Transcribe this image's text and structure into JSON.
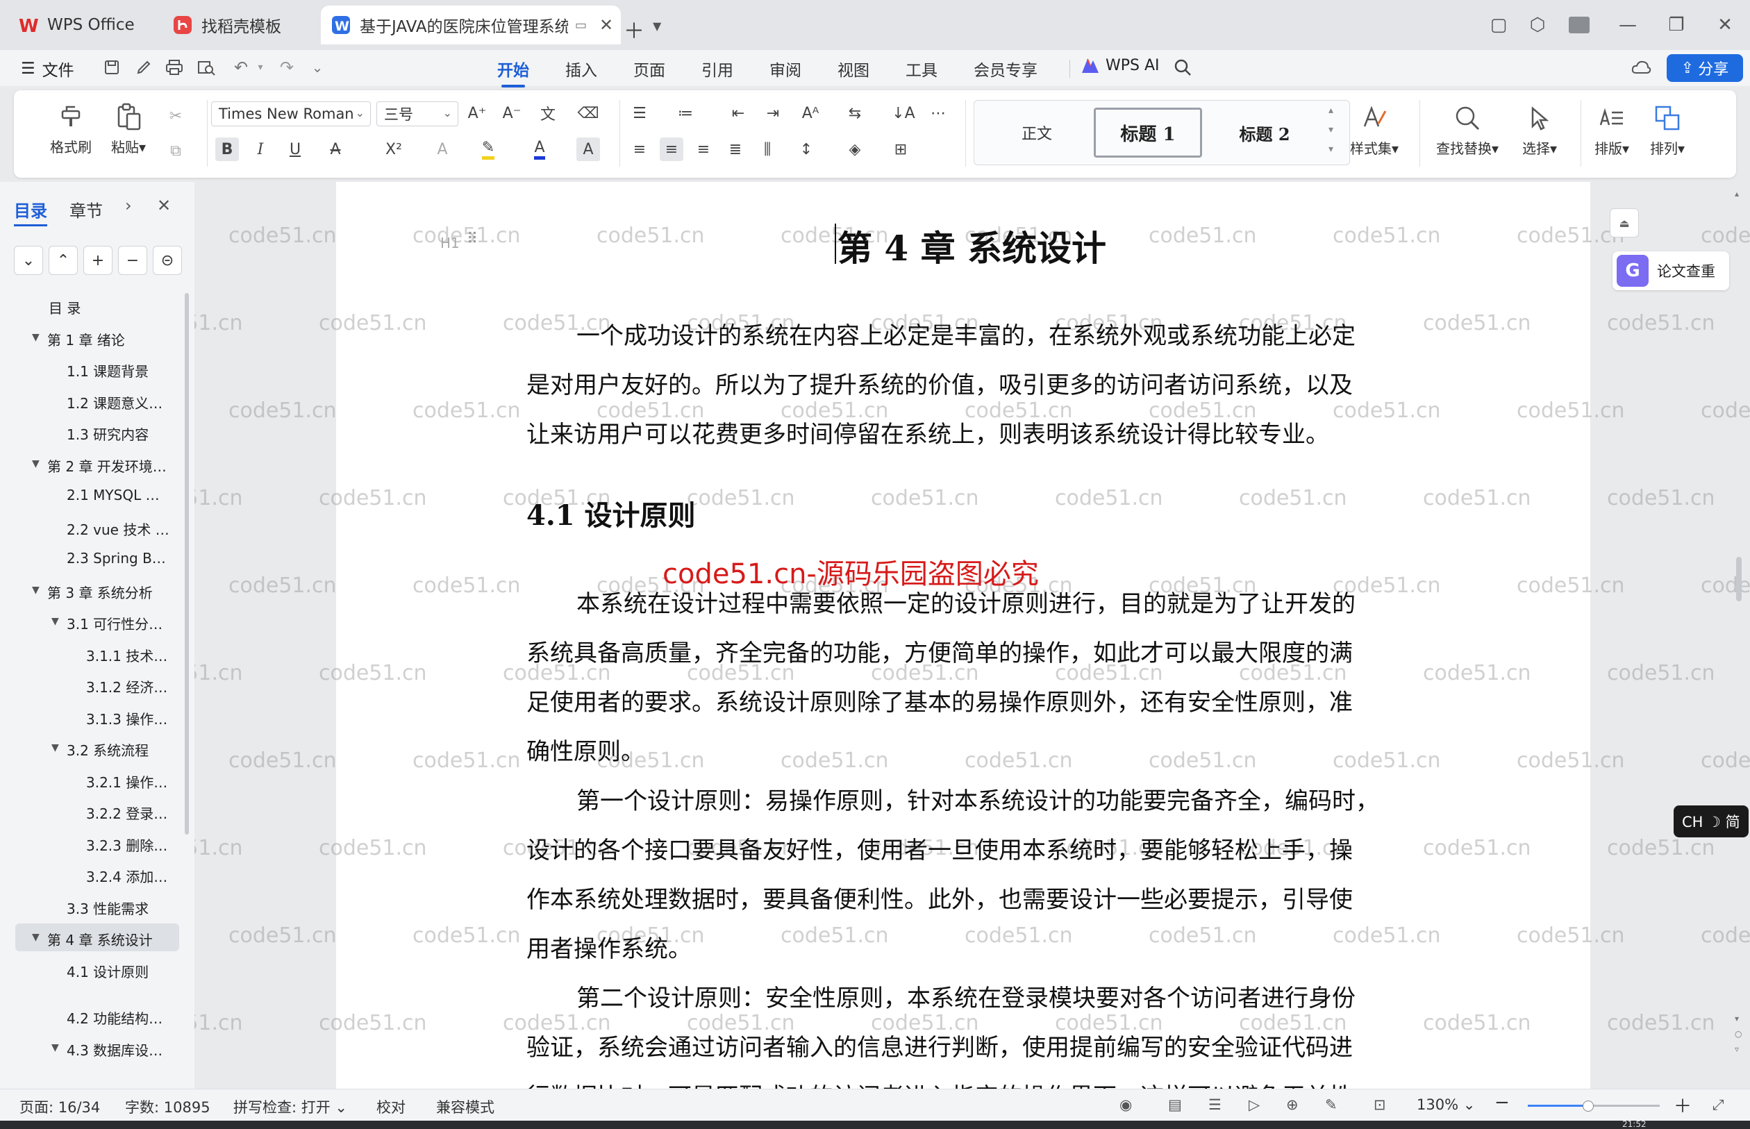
{
  "tabs": [
    {
      "label": "WPS Office",
      "active": false
    },
    {
      "label": "找稻壳模板",
      "active": false
    },
    {
      "label": "基于JAVA的医院床位管理系统",
      "active": true
    }
  ],
  "menu": {
    "file": "文件",
    "items": [
      "开始",
      "插入",
      "页面",
      "引用",
      "审阅",
      "视图",
      "工具",
      "会员专享"
    ],
    "active": "开始",
    "wps_ai": "WPS AI",
    "share": "分享"
  },
  "ribbon": {
    "format_painter": "格式刷",
    "paste": "粘贴",
    "font_name": "Times New Roman",
    "font_size": "三号",
    "styles": [
      "正文",
      "标题 1",
      "标题 2"
    ],
    "style_set": "样式集",
    "find_replace": "查找替换",
    "select": "选择",
    "layout": "排版",
    "arrange": "排列"
  },
  "nav": {
    "tab_toc": "目录",
    "tab_chapter": "章节",
    "items": [
      {
        "label": "目  录",
        "level": 0,
        "arrow": ""
      },
      {
        "label": "第 1 章  绪论",
        "level": 1,
        "arrow": "▼"
      },
      {
        "label": "1.1  课题背景",
        "level": 2,
        "arrow": ""
      },
      {
        "label": "1.2  课题意义…",
        "level": 2,
        "arrow": ""
      },
      {
        "label": "1.3  研究内容",
        "level": 2,
        "arrow": ""
      },
      {
        "label": "第 2 章  开发环境…",
        "level": 1,
        "arrow": "▼"
      },
      {
        "label": "2.1 MYSQL …",
        "level": 2,
        "arrow": ""
      },
      {
        "label": "2.2 vue 技术 …",
        "level": 2,
        "arrow": ""
      },
      {
        "label": "2.3 Spring B…",
        "level": 2,
        "arrow": ""
      },
      {
        "label": "第 3 章  系统分析",
        "level": 1,
        "arrow": "▼"
      },
      {
        "label": "3.1  可行性分…",
        "level": 2,
        "arrow": "▼"
      },
      {
        "label": "3.1.1  技术…",
        "level": 3,
        "arrow": ""
      },
      {
        "label": "3.1.2  经济…",
        "level": 3,
        "arrow": ""
      },
      {
        "label": "3.1.3  操作…",
        "level": 3,
        "arrow": ""
      },
      {
        "label": "3.2  系统流程",
        "level": 2,
        "arrow": "▼"
      },
      {
        "label": "3.2.1  操作…",
        "level": 3,
        "arrow": ""
      },
      {
        "label": "3.2.2  登录…",
        "level": 3,
        "arrow": ""
      },
      {
        "label": "3.2.3  删除…",
        "level": 3,
        "arrow": ""
      },
      {
        "label": "3.2.4  添加…",
        "level": 3,
        "arrow": ""
      },
      {
        "label": "3.3  性能需求",
        "level": 2,
        "arrow": ""
      },
      {
        "label": "第 4 章  系统设计",
        "level": 1,
        "arrow": "▼",
        "selected": true
      },
      {
        "label": "4.1  设计原则",
        "level": 2,
        "arrow": ""
      },
      {
        "label": "4.2  功能结构…",
        "level": 2,
        "arrow": ""
      },
      {
        "label": "4.3  数据库设…",
        "level": 2,
        "arrow": "▼"
      }
    ]
  },
  "doc": {
    "chapter_title": "第 4 章  系统设计",
    "heading_marker": "H1",
    "intro_lines": [
      "一个成功设计的系统在内容上必定是丰富的，在系统外观或系统功能上必定",
      "是对用户友好的。所以为了提升系统的价值，吸引更多的访问者访问系统，以及",
      "让来访用户可以花费更多时间停留在系统上，则表明该系统设计得比较专业。"
    ],
    "section_title": "4.1  设计原则",
    "red_watermark": "code51.cn-源码乐园盗图必究",
    "p1_lines": [
      "本系统在设计过程中需要依照一定的设计原则进行，目的就是为了让开发的",
      "系统具备高质量，齐全完备的功能，方便简单的操作，如此才可以最大限度的满",
      "足使用者的要求。系统设计原则除了基本的易操作原则外，还有安全性原则，准",
      "确性原则。"
    ],
    "p2_lines": [
      "第一个设计原则：易操作原则，针对本系统设计的功能要完备齐全，编码时，",
      "设计的各个接口要具备友好性，使用者一旦使用本系统时，要能够轻松上手，操",
      "作本系统处理数据时，要具备便利性。此外，也需要设计一些必要提示，引导使",
      "用者操作系统。"
    ],
    "p3_lines": [
      "第二个设计原则：安全性原则，本系统在登录模块要对各个访问者进行身份",
      "验证，系统会通过访问者输入的信息进行判断，使用提前编写的安全验证代码进",
      "行数据比对，可是匹配成功的访问者进入指定的操作界面，这样可以避免无关性"
    ],
    "watermark_text": "code51.cn",
    "side_plagiarism_check": "论文查重",
    "ime_badge": "CH ☽ 简"
  },
  "status": {
    "page": "页面: 16/34",
    "words": "字数: 10895",
    "spellcheck": "拼写检查: 打开",
    "proofread": "校对",
    "compat": "兼容模式",
    "zoom": "130%",
    "zoom_level": 0.45,
    "clock": "21:52"
  },
  "colors": {
    "accent": "#1e5fd6",
    "share_bg": "#1e6be0",
    "red_watermark": "#d71a1a",
    "wps_red": "#e02b2b"
  }
}
